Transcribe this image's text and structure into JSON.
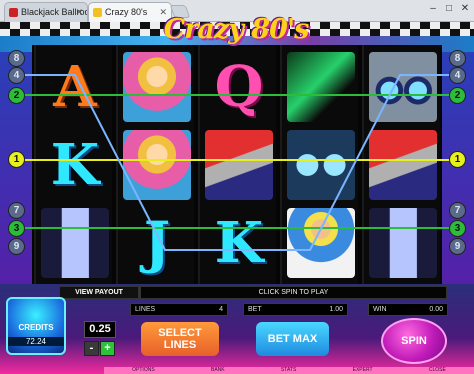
{
  "browser": {
    "tabs": [
      {
        "label": "Blackjack Ballroom Casino",
        "active": false
      },
      {
        "label": "Crazy 80's",
        "active": true
      }
    ]
  },
  "game": {
    "title": "Crazy 80's",
    "reels": [
      [
        "A",
        "K",
        "pic-bottle"
      ],
      [
        "pic-girl",
        "pic-girl",
        "J"
      ],
      [
        "Q",
        "pic-phone",
        "K"
      ],
      [
        "pic-shoe",
        "pic-glasses",
        "pic-dude"
      ],
      [
        "pic-boombox",
        "pic-phone",
        "pic-bottle"
      ]
    ],
    "paylines_left": [
      {
        "label": "8",
        "style": "side"
      },
      {
        "label": "4",
        "style": "side"
      },
      {
        "label": "2",
        "style": "g"
      },
      {
        "label": "1",
        "style": "y"
      },
      {
        "label": "7",
        "style": "side"
      },
      {
        "label": "3",
        "style": "g"
      },
      {
        "label": "9",
        "style": "side"
      }
    ],
    "paylines_right": [
      {
        "label": "8",
        "style": "side"
      },
      {
        "label": "4",
        "style": "side"
      },
      {
        "label": "2",
        "style": "g"
      },
      {
        "label": "1",
        "style": "y"
      },
      {
        "label": "7",
        "style": "side"
      },
      {
        "label": "3",
        "style": "g"
      },
      {
        "label": "9",
        "style": "side"
      }
    ],
    "line_colors": {
      "line1": "#e7ef1c",
      "line2": "#2bbd3a",
      "line3": "#2bbd3a",
      "line4": "#7ab6ff"
    }
  },
  "controls": {
    "view_payout": "VIEW PAYOUT",
    "message": "CLICK SPIN TO PLAY",
    "lines_label": "LINES",
    "lines_value": "4",
    "bet_label": "BET",
    "bet_value": "1.00",
    "win_label": "WIN",
    "win_value": "0.00",
    "credits_label": "CREDITS",
    "credits_value": "72.24",
    "coin_value": "0.25",
    "minus_label": "-",
    "plus_label": "+",
    "select_lines_label": "SELECT LINES",
    "bet_max_label": "BET MAX",
    "spin_label": "SPIN",
    "menu": [
      "OPTIONS",
      "BANK",
      "STATS",
      "EXPERT",
      "CLOSE"
    ]
  }
}
